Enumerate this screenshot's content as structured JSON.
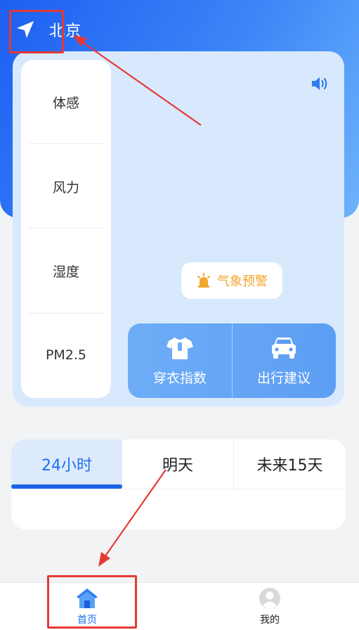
{
  "header": {
    "city": "北京",
    "icons": {
      "location": "location-arrow-icon",
      "sound": "speaker-icon"
    }
  },
  "side_metrics": [
    "体感",
    "风力",
    "湿度",
    "PM2.5"
  ],
  "alert": {
    "label": "气象预警",
    "icon": "warning-light-icon",
    "color": "#f2a52d"
  },
  "actions": [
    {
      "label": "穿衣指数",
      "icon": "tshirt-icon"
    },
    {
      "label": "出行建议",
      "icon": "car-icon"
    }
  ],
  "forecast_tabs": [
    {
      "label": "24小时",
      "active": true
    },
    {
      "label": "明天",
      "active": false
    },
    {
      "label": "未来15天",
      "active": false
    }
  ],
  "bottom_nav": [
    {
      "label": "首页",
      "icon": "home-icon",
      "active": true
    },
    {
      "label": "我的",
      "icon": "profile-avatar-icon",
      "active": false
    }
  ],
  "colors": {
    "accent": "#1e6ff0",
    "hero_start": "#1d5ff2",
    "hero_end": "#6db3fb",
    "annotation": "#e53935"
  }
}
